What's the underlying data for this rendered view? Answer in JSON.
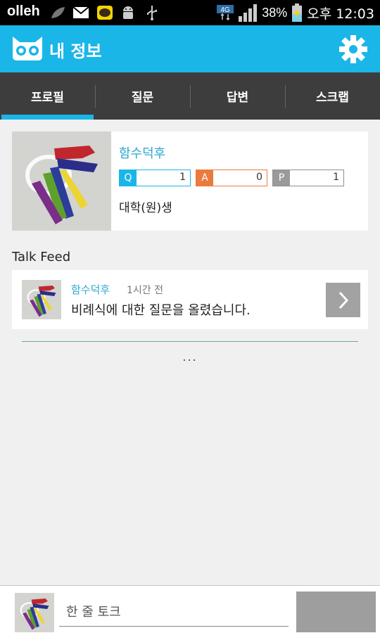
{
  "status_bar": {
    "carrier": "olleh",
    "network": "4G",
    "battery_pct": "38%",
    "clock": "오후 12:03",
    "icons": [
      "leaf-icon",
      "mail-icon",
      "kakaotalk-icon",
      "android-icon",
      "usb-icon",
      "signal-icon",
      "battery-icon"
    ]
  },
  "app_bar": {
    "title": "내 정보",
    "logo_icon": "owl-logo-icon",
    "settings_icon": "gear-icon",
    "color": "#1ab6e8"
  },
  "tabs": [
    {
      "label": "프로필",
      "active": true
    },
    {
      "label": "질문",
      "active": false
    },
    {
      "label": "답변",
      "active": false
    },
    {
      "label": "스크랩",
      "active": false
    }
  ],
  "profile": {
    "username": "함수덕후",
    "stats": [
      {
        "letter": "Q",
        "value": "1",
        "color": "#1ab6e8"
      },
      {
        "letter": "A",
        "value": "0",
        "color": "#ea7b3e"
      },
      {
        "letter": "P",
        "value": "1",
        "color": "#9a9a9a"
      }
    ],
    "grade": "대학(원)생"
  },
  "talk_feed": {
    "heading": "Talk Feed",
    "items": [
      {
        "user": "함수덕후",
        "time": "1시간 전",
        "message": "비례식에 대한 질문을 올렸습니다."
      }
    ],
    "more": "..."
  },
  "bottom_bar": {
    "input_placeholder": "한 줄 토크",
    "input_value": ""
  }
}
